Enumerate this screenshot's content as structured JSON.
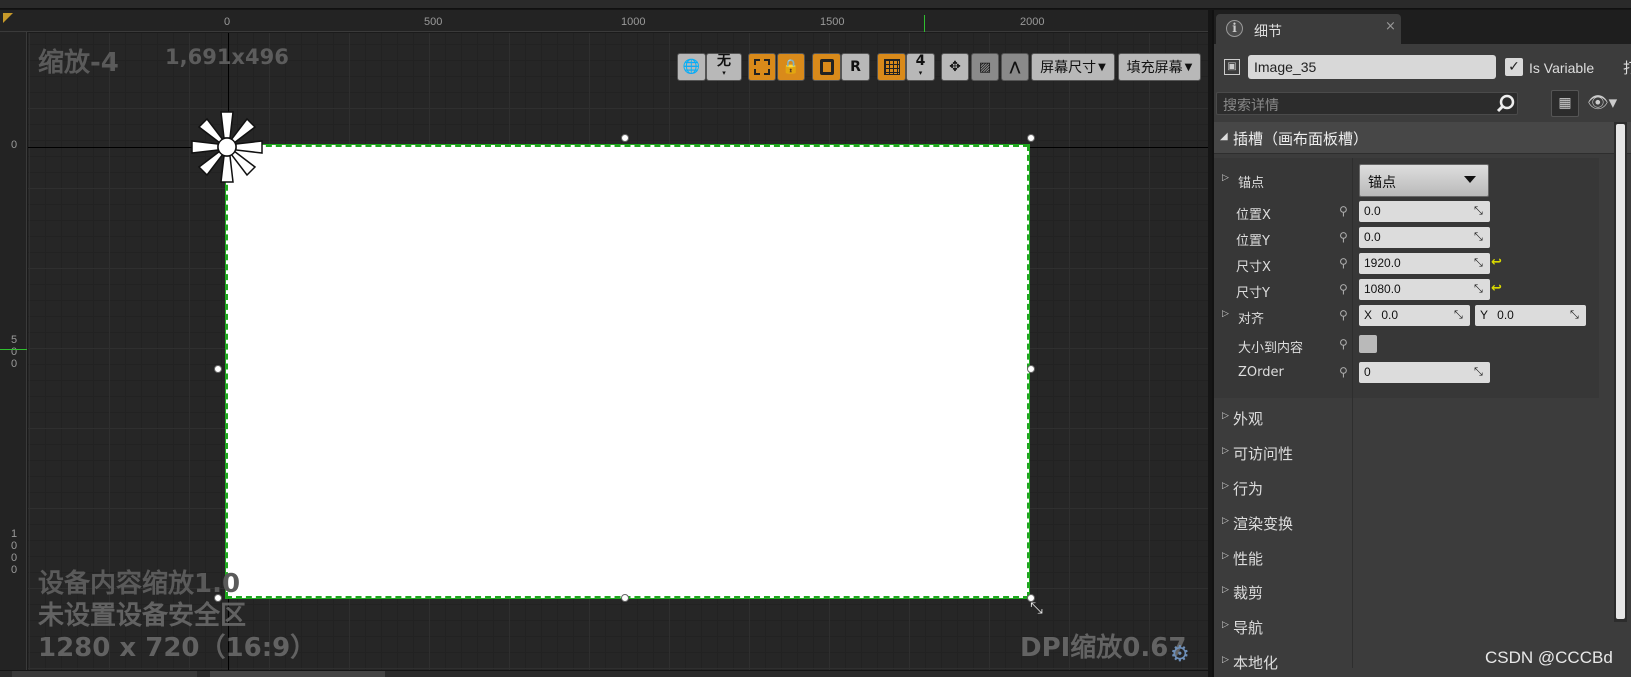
{
  "designer": {
    "zoom_text": "缩放-4",
    "resolution_text": "1,691x496",
    "ruler_top_ticks": [
      "0",
      "500",
      "1000",
      "1500",
      "2000"
    ],
    "ruler_left_ticks": [
      "0",
      "5\n0\n0",
      "1\n0\n0\n0"
    ],
    "device_scale_text": "设备内容缩放1.0",
    "safe_zone_text": "未设置设备安全区",
    "device_res_text": "1280 x 720（16:9）",
    "dpi_text": "DPI缩放0.67",
    "toolbar": {
      "locale_value": "无",
      "grid_snap_value": "4",
      "r_label": "R",
      "screen_size_label": "屏幕尺寸",
      "fill_screen_label": "填充屏幕"
    }
  },
  "details": {
    "tab_title": "细节",
    "widget_name": "Image_35",
    "is_variable_label": "Is Variable",
    "is_variable_checked": true,
    "cut_char": "打",
    "search_placeholder": "搜索详情",
    "slot_section_title": "插槽（画布面板槽）",
    "properties": {
      "anchor": {
        "label": "锚点",
        "value": "锚点"
      },
      "pos_x": {
        "label": "位置X",
        "value": "0.0"
      },
      "pos_y": {
        "label": "位置Y",
        "value": "0.0"
      },
      "size_x": {
        "label": "尺寸X",
        "value": "1920.0"
      },
      "size_y": {
        "label": "尺寸Y",
        "value": "1080.0"
      },
      "alignment": {
        "label": "对齐",
        "x_label": "X",
        "x_value": "0.0",
        "y_label": "Y",
        "y_value": "0.0"
      },
      "size_to_content": {
        "label": "大小到内容",
        "checked": false
      },
      "zorder": {
        "label": "ZOrder",
        "value": "0"
      }
    },
    "categories": [
      "外观",
      "可访问性",
      "行为",
      "渲染变换",
      "性能",
      "裁剪",
      "导航",
      "本地化"
    ]
  },
  "watermark": "CSDN @CCCBd",
  "colors": {
    "selection_green": "#1fa81f",
    "toolbar_orange": "#d98a1a",
    "reset_yellow": "#d8d800"
  }
}
